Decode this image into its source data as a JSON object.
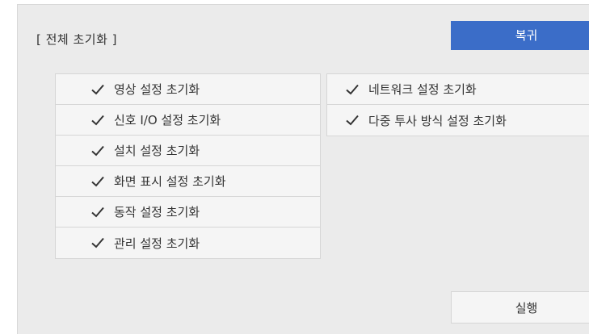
{
  "header": {
    "title": "[ 전체 초기화 ]",
    "return_label": "복귀"
  },
  "left_items": [
    {
      "label": "영상 설정 초기화",
      "checked": true,
      "icon": "checkmark-icon"
    },
    {
      "label": "신호 I/O 설정 초기화",
      "checked": true,
      "icon": "checkmark-icon"
    },
    {
      "label": "설치 설정 초기화",
      "checked": true,
      "icon": "checkmark-icon"
    },
    {
      "label": "화면 표시 설정 초기화",
      "checked": true,
      "icon": "checkmark-icon"
    },
    {
      "label": "동작 설정 초기화",
      "checked": true,
      "icon": "checkmark-icon"
    },
    {
      "label": "관리 설정 초기화",
      "checked": true,
      "icon": "checkmark-icon"
    }
  ],
  "right_items": [
    {
      "label": "네트워크 설정 초기화",
      "checked": true,
      "icon": "checkmark-icon"
    },
    {
      "label": "다중 투사 방식 설정 초기화",
      "checked": true,
      "icon": "checkmark-icon"
    }
  ],
  "footer": {
    "execute_label": "실행"
  },
  "colors": {
    "accent": "#3b6dc8",
    "panel_bg": "#ebebeb",
    "item_bg": "#f5f5f5",
    "border": "#d6d6d6",
    "text": "#333333"
  }
}
